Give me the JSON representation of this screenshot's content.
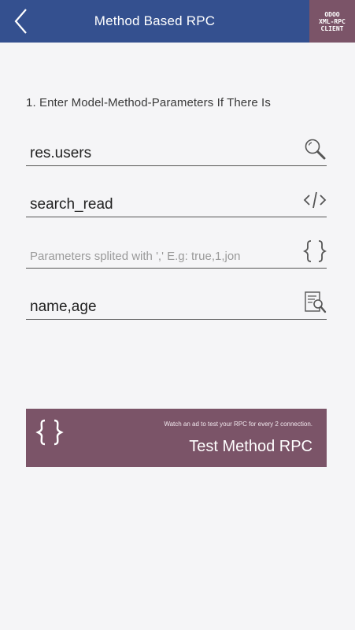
{
  "header": {
    "title": "Method Based RPC",
    "logo_lines": [
      "ODOO",
      "XML-RPC",
      "CLIENT"
    ]
  },
  "form": {
    "instruction": "1. Enter Model-Method-Parameters If There Is",
    "model": {
      "value": "res.users",
      "icon": "search-icon"
    },
    "method": {
      "value": "search_read",
      "icon": "code-icon"
    },
    "parameters": {
      "value": "",
      "placeholder": "Parameters splited with ',' E.g: true,1,jon",
      "icon": "braces-icon"
    },
    "fields": {
      "value": "name,age",
      "icon": "document-search-icon"
    }
  },
  "action": {
    "hint": "Watch an ad to test your RPC for every 2 connection.",
    "label": "Test Method RPC",
    "icon": "braces-icon"
  },
  "colors": {
    "header": "#34508f",
    "accent": "#7b5468",
    "background": "#f5f5f7"
  }
}
